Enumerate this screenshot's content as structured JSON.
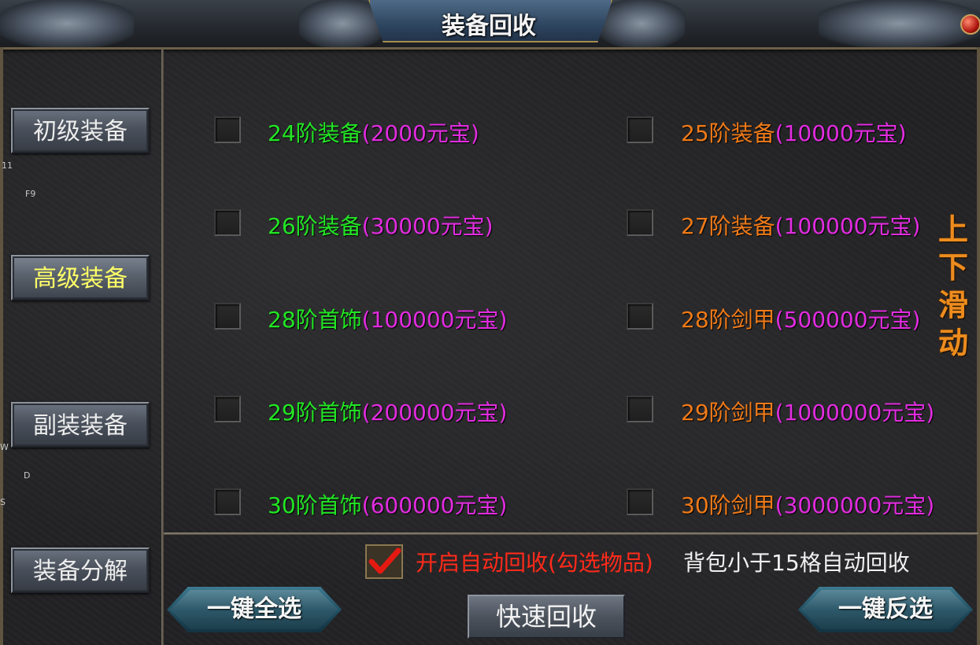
{
  "window": {
    "title": "装备回收"
  },
  "sidebar": {
    "items": [
      {
        "label": "初级装备",
        "active": false
      },
      {
        "label": "高级装备",
        "active": true
      },
      {
        "label": "副装装备",
        "active": false
      },
      {
        "label": "装备分解",
        "active": false
      }
    ],
    "stray_text": [
      "11",
      "F9",
      "W",
      "D",
      "S"
    ]
  },
  "items": [
    {
      "name": "24阶装备",
      "price": "(2000元宝)",
      "name_color": "#22e624"
    },
    {
      "name": "25阶装备",
      "price": "(10000元宝)",
      "name_color": "#f07a18"
    },
    {
      "name": "26阶装备",
      "price": "(30000元宝)",
      "name_color": "#22e624"
    },
    {
      "name": "27阶装备",
      "price": "(100000元宝)",
      "name_color": "#f07a18"
    },
    {
      "name": "28阶首饰",
      "price": "(100000元宝)",
      "name_color": "#22e624"
    },
    {
      "name": "28阶剑甲",
      "price": "(500000元宝)",
      "name_color": "#f07a18"
    },
    {
      "name": "29阶首饰",
      "price": "(200000元宝)",
      "name_color": "#22e624"
    },
    {
      "name": "29阶剑甲",
      "price": "(1000000元宝)",
      "name_color": "#f07a18"
    },
    {
      "name": "30阶首饰",
      "price": "(600000元宝)",
      "name_color": "#22e624"
    },
    {
      "name": "30阶剑甲",
      "price": "(3000000元宝)",
      "name_color": "#f07a18"
    }
  ],
  "scroll_hint": [
    "上",
    "下",
    "滑",
    "动"
  ],
  "auto_recycle": {
    "checked": true,
    "label": "开启自动回收(勾选物品)",
    "hint": "背包小于15格自动回收"
  },
  "buttons": {
    "select_all": "一键全选",
    "quick_recycle": "快速回收",
    "invert_select": "一键反选"
  },
  "colors": {
    "price": "#e22ce0",
    "auto_label": "#ff2a1a",
    "scroll_hint": "#ec8c1e",
    "active_tab": "#ffff66"
  }
}
